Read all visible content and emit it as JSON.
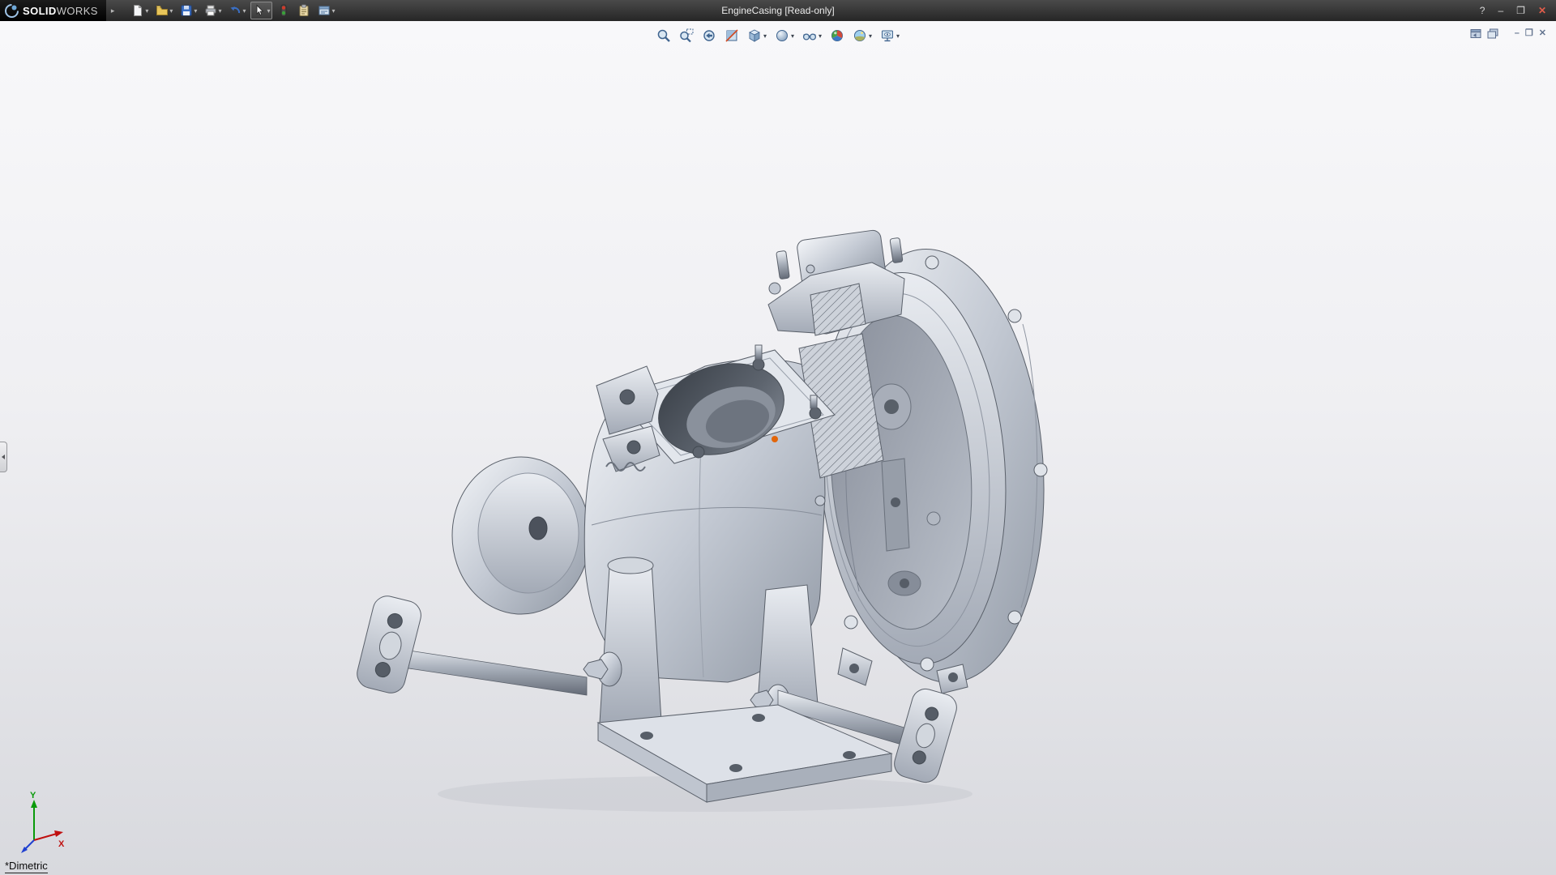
{
  "title_bar": {
    "brand_bold": "SOLID",
    "brand_light": "WORKS",
    "menu_expand_glyph": "▸",
    "document_title": "EngineCasing [Read-only]",
    "toolbar": {
      "dropdown_glyph": "▾",
      "items": [
        {
          "name": "new-document",
          "dropdown": true
        },
        {
          "name": "open-document",
          "dropdown": true
        },
        {
          "name": "save",
          "dropdown": true
        },
        {
          "name": "print",
          "dropdown": true
        },
        {
          "name": "undo",
          "dropdown": true
        },
        {
          "name": "select",
          "dropdown": true,
          "active": true
        },
        {
          "name": "rebuild",
          "dropdown": false
        },
        {
          "name": "file-properties",
          "dropdown": false
        },
        {
          "name": "options",
          "dropdown": true
        }
      ]
    },
    "window_controls": {
      "help": "?",
      "minimize": "–",
      "maximize": "❐",
      "close": "✕"
    }
  },
  "heads_up_toolbar": {
    "dropdown_glyph": "▾",
    "items": [
      {
        "name": "zoom-to-fit",
        "dropdown": false
      },
      {
        "name": "zoom-to-area",
        "dropdown": false
      },
      {
        "name": "previous-view",
        "dropdown": false
      },
      {
        "name": "section-view",
        "dropdown": false
      },
      {
        "name": "view-orientation",
        "dropdown": true
      },
      {
        "name": "display-style",
        "dropdown": true
      },
      {
        "name": "hide-show-items",
        "dropdown": true
      },
      {
        "name": "edit-appearance",
        "dropdown": false
      },
      {
        "name": "apply-scene",
        "dropdown": true
      },
      {
        "name": "view-settings",
        "dropdown": true
      }
    ]
  },
  "document_window_controls": {
    "minimize_glyph": "–",
    "restore_glyph": "❐",
    "close_glyph": "✕"
  },
  "viewport": {
    "orientation_label": "*Dimetric",
    "triad": {
      "x_label": "X",
      "y_label": "Y"
    },
    "model": "engine-casing-assembly"
  },
  "colors": {
    "titlebar_bg": "#2e2e2e",
    "viewport_top": "#f8f8fa",
    "viewport_bottom": "#d8d9de",
    "metal_light": "#e7eaef",
    "metal_dark": "#9098a4",
    "origin_marker": "#e2660a",
    "axis_x": "#c01010",
    "axis_y": "#0a9a0a",
    "axis_z": "#2040d0"
  }
}
